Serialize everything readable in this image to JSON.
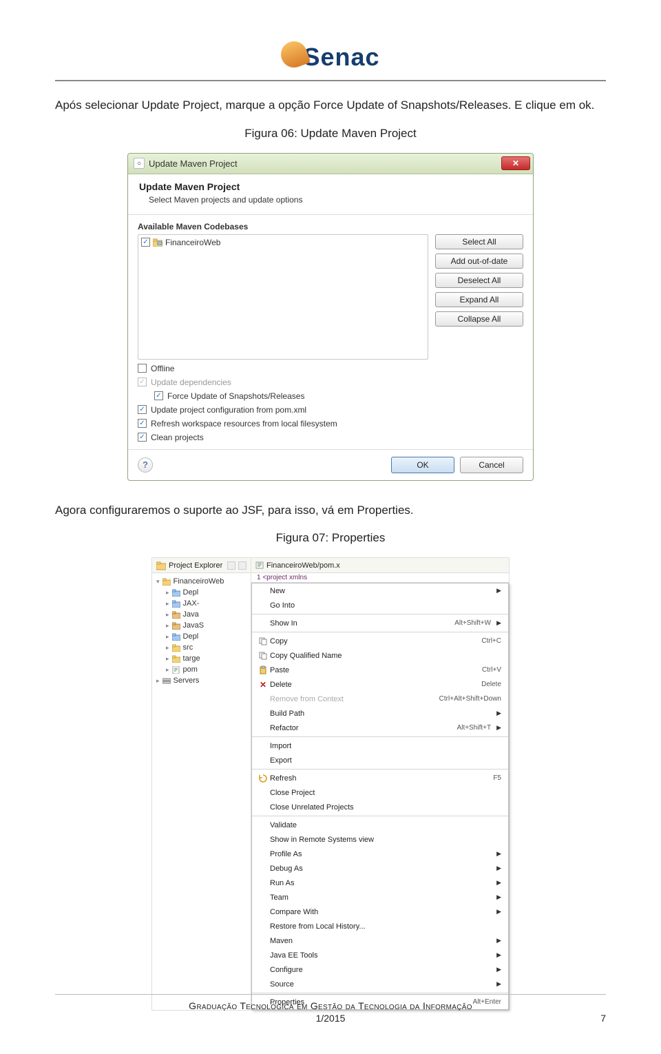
{
  "logo_text": "Senac",
  "intro": "Após selecionar Update Project, marque a opção Force Update of Snapshots/Releases. E clique em ok.",
  "fig06_caption": "Figura 06: Update Maven Project",
  "dialog1": {
    "title": "Update Maven Project",
    "heading": "Update Maven Project",
    "subheading": "Select Maven projects and update options",
    "codebases_label": "Available Maven Codebases",
    "tree_item": "FinanceiroWeb",
    "buttons": {
      "select_all": "Select All",
      "add_out_of_date": "Add out-of-date",
      "deselect_all": "Deselect All",
      "expand_all": "Expand All",
      "collapse_all": "Collapse All"
    },
    "chk_offline": "Offline",
    "chk_update_deps": "Update dependencies",
    "chk_force": "Force Update of Snapshots/Releases",
    "chk_pom": "Update project configuration from pom.xml",
    "chk_refresh": "Refresh workspace resources from local filesystem",
    "chk_clean": "Clean projects",
    "ok": "OK",
    "cancel": "Cancel"
  },
  "mid_text": "Agora configuraremos o suporte ao JSF, para isso, vá em Properties.",
  "fig07_caption": "Figura 07: Properties",
  "shot2": {
    "pe_tab": "Project Explorer",
    "tree": [
      {
        "t": "FinanceiroWeb",
        "type": "root"
      },
      {
        "t": "Depl",
        "type": "d"
      },
      {
        "t": "JAX-",
        "type": "d"
      },
      {
        "t": "Java",
        "type": "j"
      },
      {
        "t": "JavaS",
        "type": "j"
      },
      {
        "t": "Depl",
        "type": "d"
      },
      {
        "t": "src",
        "type": "f"
      },
      {
        "t": "targe",
        "type": "f"
      },
      {
        "t": "pom",
        "type": "x"
      },
      {
        "t": "Servers",
        "type": "srv"
      }
    ],
    "right_tab": "FinanceiroWeb/pom.x",
    "right_sub": "1 <project xmlns",
    "menu": [
      {
        "label": "New",
        "icon": "",
        "arrow": true
      },
      {
        "label": "Go Into"
      },
      {
        "sep": true
      },
      {
        "label": "Show In",
        "short": "Alt+Shift+W",
        "arrow": true
      },
      {
        "sep": true
      },
      {
        "label": "Copy",
        "icon": "copy",
        "short": "Ctrl+C"
      },
      {
        "label": "Copy Qualified Name",
        "icon": "copyq"
      },
      {
        "label": "Paste",
        "icon": "paste",
        "short": "Ctrl+V"
      },
      {
        "label": "Delete",
        "icon": "del",
        "short": "Delete"
      },
      {
        "label": "Remove from Context",
        "short": "Ctrl+Alt+Shift+Down",
        "disabled": true
      },
      {
        "label": "Build Path",
        "arrow": true
      },
      {
        "label": "Refactor",
        "short": "Alt+Shift+T",
        "arrow": true
      },
      {
        "sep": true
      },
      {
        "label": "Import"
      },
      {
        "label": "Export"
      },
      {
        "sep": true
      },
      {
        "label": "Refresh",
        "icon": "ref",
        "short": "F5"
      },
      {
        "label": "Close Project"
      },
      {
        "label": "Close Unrelated Projects"
      },
      {
        "sep": true
      },
      {
        "label": "Validate"
      },
      {
        "label": "Show in Remote Systems view"
      },
      {
        "label": "Profile As",
        "arrow": true
      },
      {
        "label": "Debug As",
        "arrow": true
      },
      {
        "label": "Run As",
        "arrow": true
      },
      {
        "label": "Team",
        "arrow": true
      },
      {
        "label": "Compare With",
        "arrow": true
      },
      {
        "label": "Restore from Local History..."
      },
      {
        "label": "Maven",
        "arrow": true
      },
      {
        "label": "Java EE Tools",
        "arrow": true
      },
      {
        "label": "Configure",
        "arrow": true
      },
      {
        "label": "Source",
        "arrow": true
      },
      {
        "sep": true
      },
      {
        "label": "Properties",
        "short": "Alt+Enter"
      }
    ]
  },
  "footer": {
    "line1": "Graduação Tecnológica em Gestão da Tecnologia da Informação",
    "line2": "1/2015",
    "page": "7"
  }
}
